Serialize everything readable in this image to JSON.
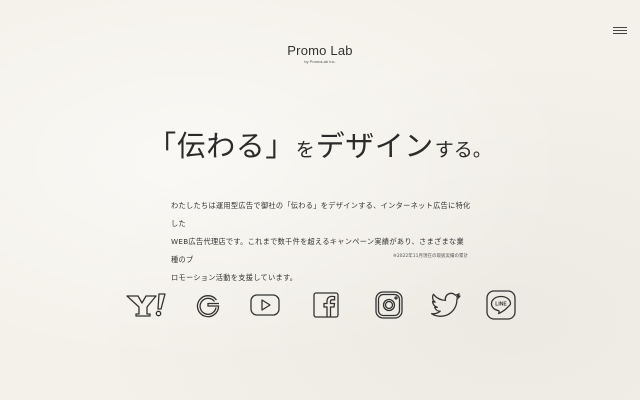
{
  "header": {
    "logo_name": "Promo Lab",
    "logo_sub": "by PromoLab Inc.",
    "menu_icon": "hamburger-menu-icon"
  },
  "hero": {
    "headline_open": "「",
    "headline_main": "伝わる",
    "headline_close": "」",
    "headline_particle": "を",
    "headline_rest": "デザイン",
    "headline_suffix": "する。",
    "description": [
      "わたしたちは運用型広告で御社の「伝わる」をデザインする、インターネット広告に特化した",
      "WEB広告代理店です。これまで数千件を超えるキャンペーン実績があり、さまざまな業種のプ",
      "ロモーション活動を支援しています。"
    ],
    "note": "※2022年11月現在の取扱実績の累計"
  },
  "social_icons": [
    "yahoo-icon",
    "google-icon",
    "youtube-icon",
    "facebook-icon",
    "instagram-icon",
    "twitter-icon",
    "line-icon"
  ],
  "line_badge_text": "LINE",
  "colors": {
    "background": "#f4f1ea",
    "text": "#333333",
    "icon_stroke": "#333333"
  }
}
